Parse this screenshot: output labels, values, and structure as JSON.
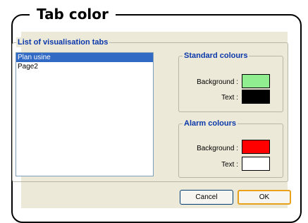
{
  "frame": {
    "title": "Tab color"
  },
  "dialog": {
    "list_group_label": "List of visualisation tabs",
    "tabs": [
      {
        "label": "Plan usine",
        "selected": true
      },
      {
        "label": "Page2",
        "selected": false
      }
    ],
    "standard_colours": {
      "label": "Standard colours",
      "background_label": "Background :",
      "text_label": "Text :",
      "background_color": "#90ee90",
      "text_color": "#000000"
    },
    "alarm_colours": {
      "label": "Alarm colours",
      "background_label": "Background :",
      "text_label": "Text :",
      "background_color": "#ff0000",
      "text_color": "#ffffff"
    },
    "buttons": {
      "cancel": "Cancel",
      "ok": "OK"
    }
  }
}
